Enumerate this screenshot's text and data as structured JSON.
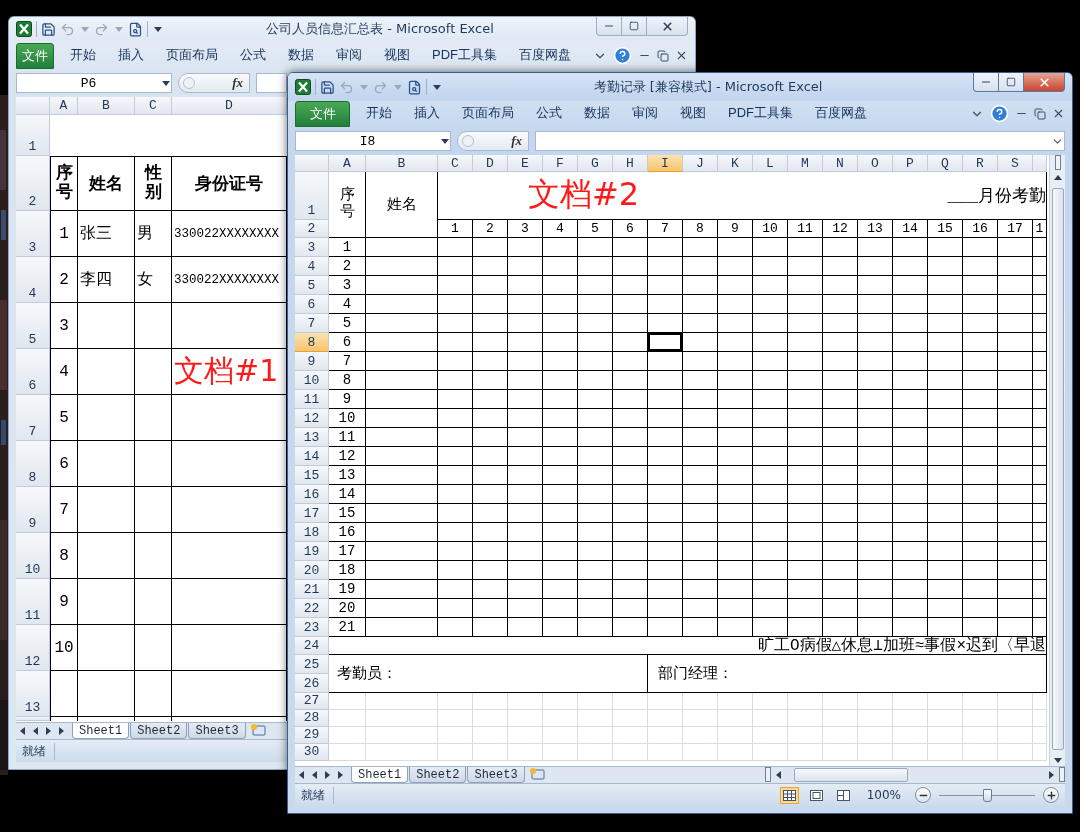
{
  "personnel_window": {
    "title": "公司人员信息汇总表 - Microsoft Excel",
    "active": false,
    "ribbon": {
      "file_tab": "文件",
      "tabs": [
        "开始",
        "插入",
        "页面布局",
        "公式",
        "数据",
        "审阅",
        "视图",
        "PDF工具集",
        "百度网盘"
      ]
    },
    "name_box": "P6",
    "fx_label": "fx",
    "columns": [
      {
        "label": "A",
        "selected": false
      },
      {
        "label": "B",
        "selected": false
      },
      {
        "label": "C",
        "selected": false
      },
      {
        "label": "D",
        "selected": false
      }
    ],
    "rows": [
      {
        "label": "1",
        "selected": false
      },
      {
        "label": "2",
        "selected": false
      },
      {
        "label": "3",
        "selected": false
      },
      {
        "label": "4",
        "selected": false
      },
      {
        "label": "5",
        "selected": false
      },
      {
        "label": "6",
        "selected": false
      },
      {
        "label": "7",
        "selected": false
      },
      {
        "label": "8",
        "selected": false
      },
      {
        "label": "9",
        "selected": false
      },
      {
        "label": "10",
        "selected": false
      },
      {
        "label": "11",
        "selected": false
      },
      {
        "label": "12",
        "selected": false
      },
      {
        "label": "13",
        "selected": false
      }
    ],
    "sheet": {
      "header": [
        "序号",
        "姓名",
        "性别",
        "身份证号"
      ],
      "records": [
        {
          "no": "1",
          "name": "张三",
          "gender": "男",
          "id": "330022XXXXXXXX"
        },
        {
          "no": "2",
          "name": "李四",
          "gender": "女",
          "id": "330022XXXXXXXX"
        },
        {
          "no": "3"
        },
        {
          "no": "4",
          "note": "文档#1"
        },
        {
          "no": "5"
        },
        {
          "no": "6"
        },
        {
          "no": "7"
        },
        {
          "no": "8"
        },
        {
          "no": "9"
        },
        {
          "no": "10"
        }
      ]
    },
    "sheet_tabs": [
      {
        "label": "Sheet1",
        "selected": true
      },
      {
        "label": "Sheet2",
        "selected": false
      },
      {
        "label": "Sheet3",
        "selected": false
      }
    ],
    "status": "就绪"
  },
  "attendance_window": {
    "title": "考勤记录 [兼容模式] - Microsoft Excel",
    "active": true,
    "ribbon": {
      "file_tab": "文件",
      "tabs": [
        "开始",
        "插入",
        "页面布局",
        "公式",
        "数据",
        "审阅",
        "视图",
        "PDF工具集",
        "百度网盘"
      ]
    },
    "name_box": "I8",
    "fx_label": "fx",
    "columns": [
      {
        "label": "A",
        "selected": false
      },
      {
        "label": "B",
        "selected": false
      },
      {
        "label": "C",
        "selected": false
      },
      {
        "label": "D",
        "selected": false
      },
      {
        "label": "E",
        "selected": false
      },
      {
        "label": "F",
        "selected": false
      },
      {
        "label": "G",
        "selected": false
      },
      {
        "label": "H",
        "selected": false
      },
      {
        "label": "I",
        "selected": true
      },
      {
        "label": "J",
        "selected": false
      },
      {
        "label": "K",
        "selected": false
      },
      {
        "label": "L",
        "selected": false
      },
      {
        "label": "M",
        "selected": false
      },
      {
        "label": "N",
        "selected": false
      },
      {
        "label": "O",
        "selected": false
      },
      {
        "label": "P",
        "selected": false
      },
      {
        "label": "Q",
        "selected": false
      },
      {
        "label": "R",
        "selected": false
      },
      {
        "label": "S",
        "selected": false
      }
    ],
    "rows": [
      {
        "label": "1",
        "selected": false
      },
      {
        "label": "2",
        "selected": false
      },
      {
        "label": "3",
        "selected": false
      },
      {
        "label": "4",
        "selected": false
      },
      {
        "label": "5",
        "selected": false
      },
      {
        "label": "6",
        "selected": false
      },
      {
        "label": "7",
        "selected": false
      },
      {
        "label": "8",
        "selected": true
      },
      {
        "label": "9",
        "selected": false
      },
      {
        "label": "10",
        "selected": false
      },
      {
        "label": "11",
        "selected": false
      },
      {
        "label": "12",
        "selected": false
      },
      {
        "label": "13",
        "selected": false
      },
      {
        "label": "14",
        "selected": false
      },
      {
        "label": "15",
        "selected": false
      },
      {
        "label": "16",
        "selected": false
      },
      {
        "label": "17",
        "selected": false
      },
      {
        "label": "18",
        "selected": false
      },
      {
        "label": "19",
        "selected": false
      },
      {
        "label": "20",
        "selected": false
      },
      {
        "label": "21",
        "selected": false
      },
      {
        "label": "22",
        "selected": false
      },
      {
        "label": "23",
        "selected": false
      },
      {
        "label": "24",
        "selected": false
      },
      {
        "label": "25",
        "selected": false
      },
      {
        "label": "26",
        "selected": false
      },
      {
        "label": "27",
        "selected": false
      },
      {
        "label": "28",
        "selected": false
      },
      {
        "label": "29",
        "selected": false
      },
      {
        "label": "30",
        "selected": false
      }
    ],
    "sheet": {
      "number_header": "序号",
      "name_header": "姓名",
      "title": "___月份考勤",
      "overlay_label": "文档#2",
      "days": [
        "1",
        "2",
        "3",
        "4",
        "5",
        "6",
        "7",
        "8",
        "9",
        "10",
        "11",
        "12",
        "13",
        "14",
        "15",
        "16",
        "17",
        "1"
      ],
      "numbers": [
        "1",
        "2",
        "3",
        "4",
        "5",
        "6",
        "7",
        "8",
        "9",
        "10",
        "11",
        "12",
        "13",
        "14",
        "15",
        "16",
        "17",
        "18",
        "19",
        "20",
        "21"
      ],
      "legend": "旷工O病假△休息⊥加班≈事假×迟到〈早退",
      "clerk_label": "考勤员：",
      "manager_label": "部门经理："
    },
    "sheet_tabs": [
      {
        "label": "Sheet1",
        "selected": true
      },
      {
        "label": "Sheet2",
        "selected": false
      },
      {
        "label": "Sheet3",
        "selected": false
      }
    ],
    "status": "就绪",
    "view_buttons": [
      {
        "kind": "normal",
        "selected": true
      },
      {
        "kind": "page-layout",
        "selected": false
      },
      {
        "kind": "page-break",
        "selected": false
      }
    ],
    "zoom": {
      "reading": "100%",
      "level": 0.5
    }
  }
}
